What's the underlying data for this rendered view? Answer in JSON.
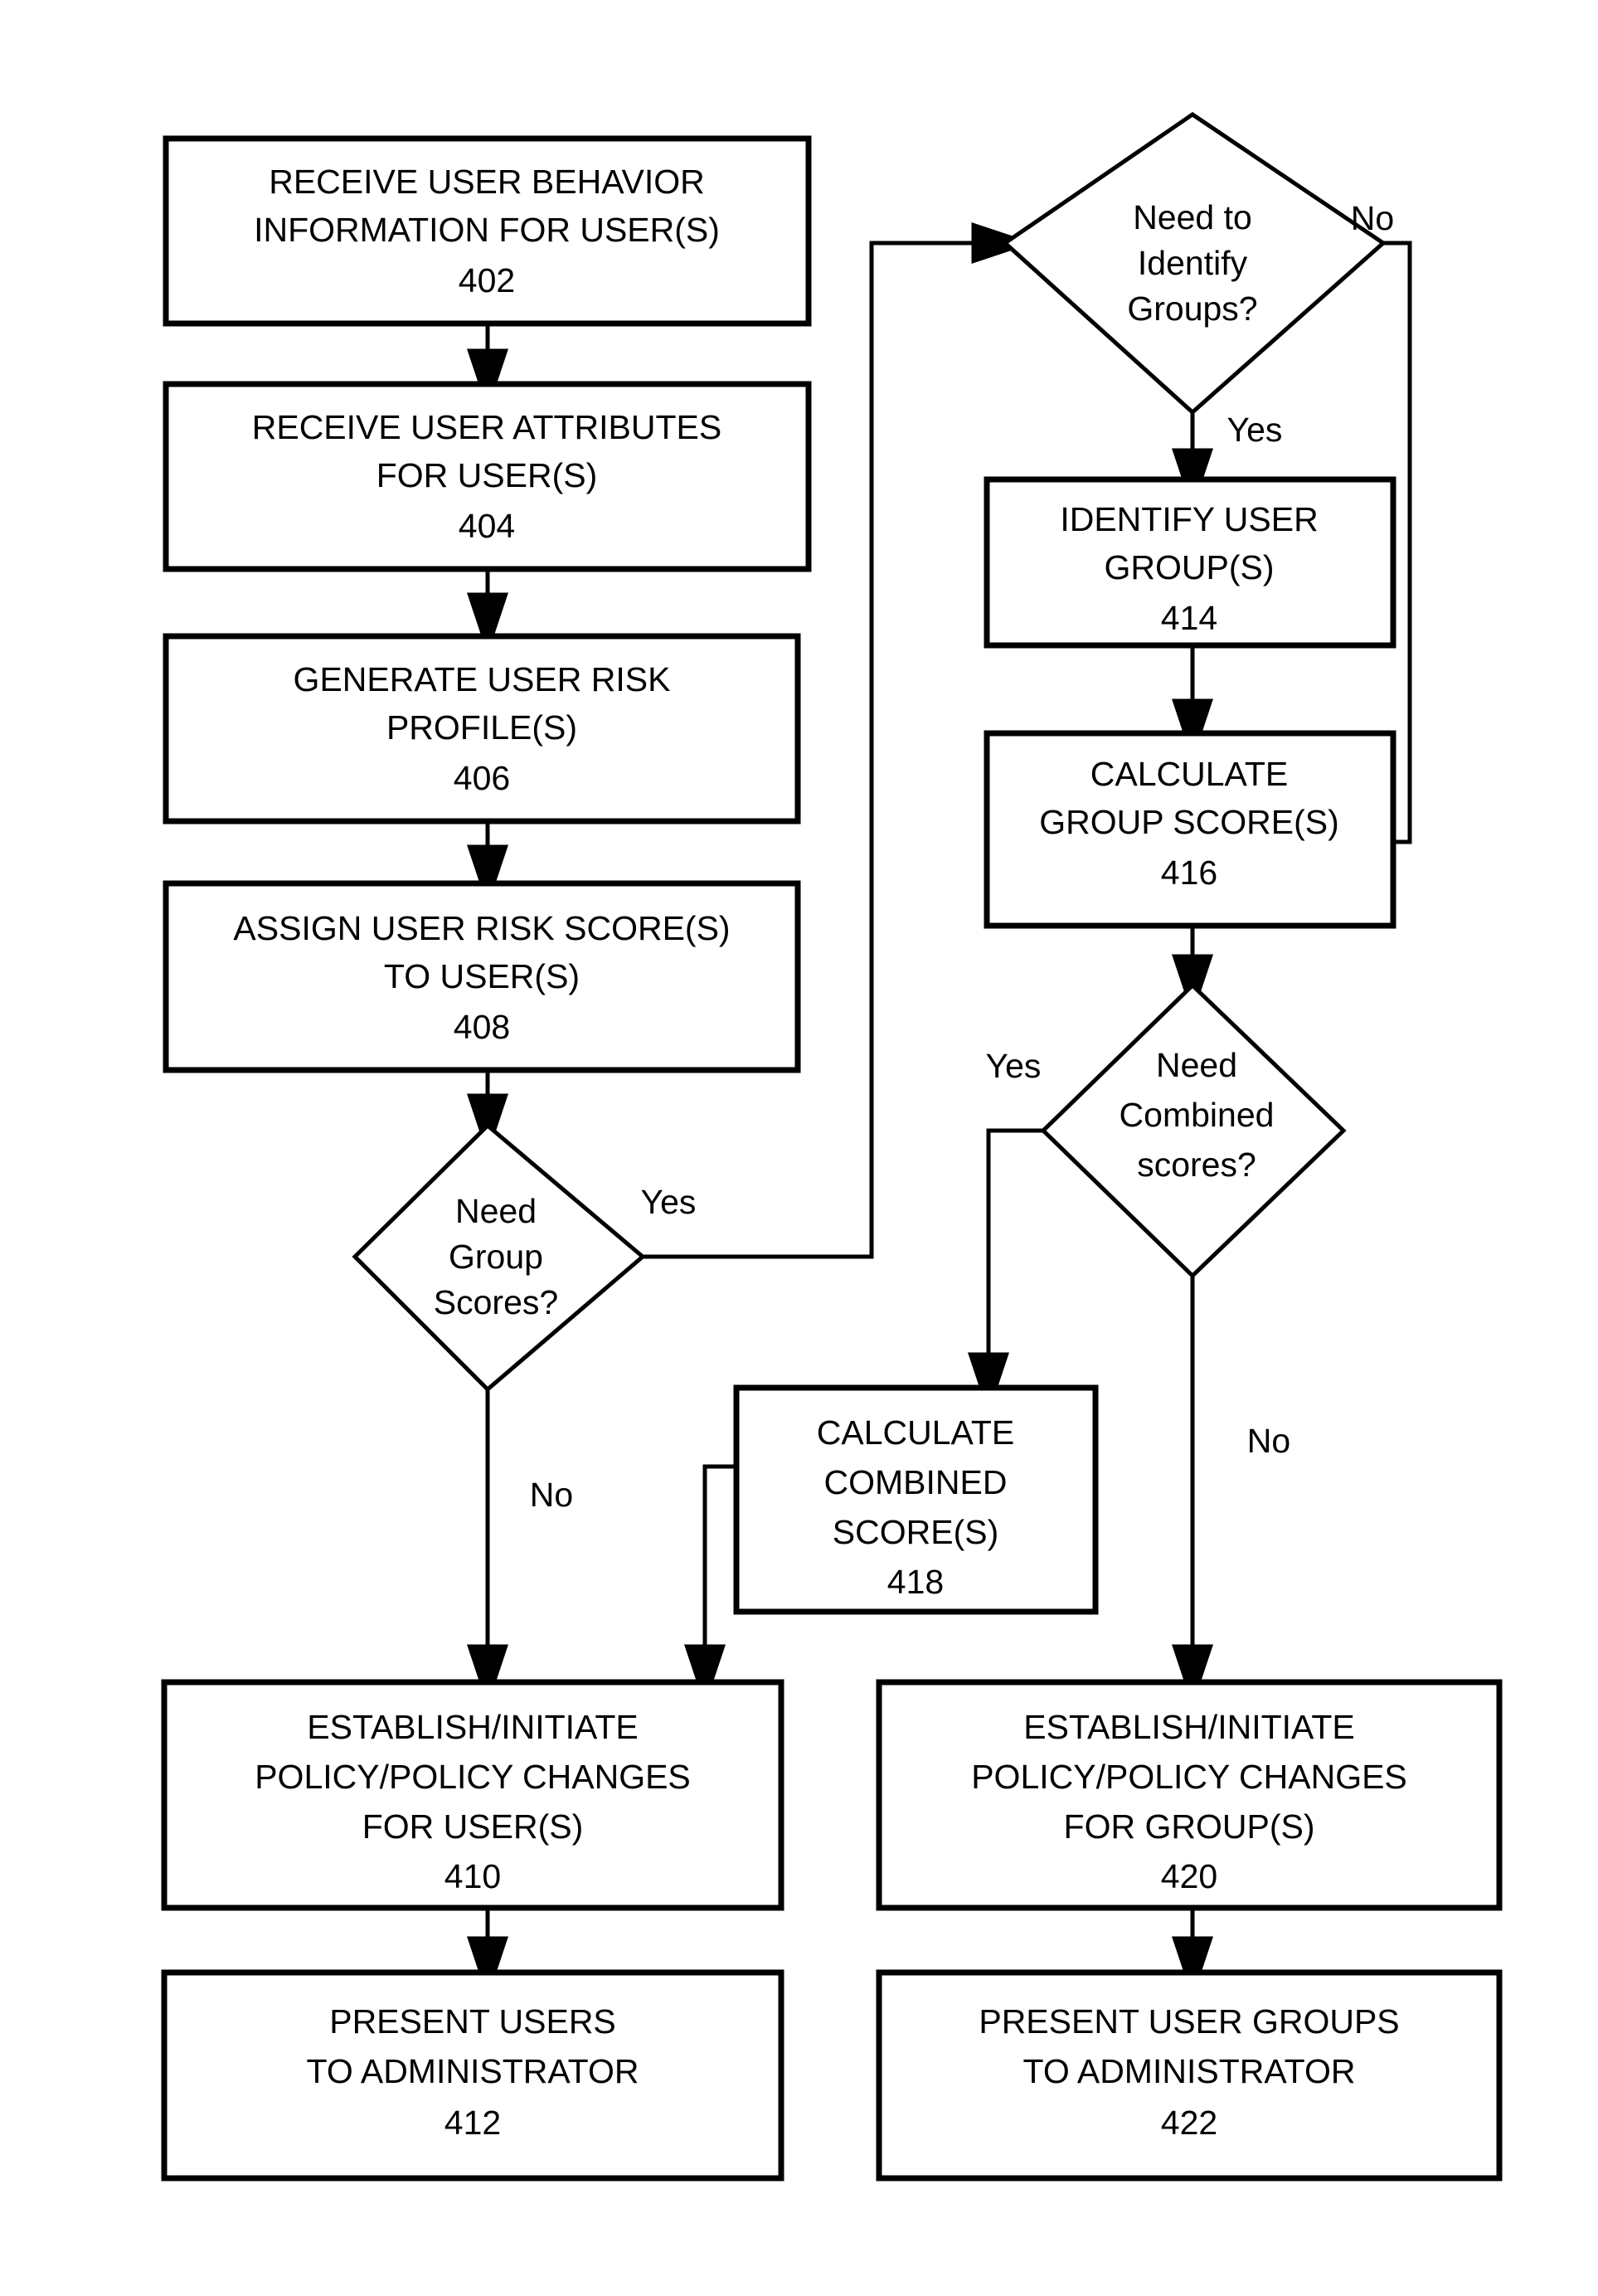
{
  "figure": {
    "type": "process-flowchart",
    "background_color": "#ffffff",
    "line_color": "#000000",
    "text_color": "#000000"
  },
  "nodes": {
    "n402": {
      "shape": "process",
      "line1": "RECEIVE USER BEHAVIOR",
      "line2": "INFORMATION FOR USER(S)",
      "ref": "402"
    },
    "n404": {
      "shape": "process",
      "line1": "RECEIVE USER ATTRIBUTES",
      "line2": "FOR USER(S)",
      "ref": "404"
    },
    "n406": {
      "shape": "process",
      "line1": "GENERATE USER RISK",
      "line2": "PROFILE(S)",
      "ref": "406"
    },
    "n408": {
      "shape": "process",
      "line1": "ASSIGN USER RISK SCORE(S)",
      "line2": "TO USER(S)",
      "ref": "408"
    },
    "n410": {
      "shape": "process",
      "line1": "ESTABLISH/INITIATE",
      "line2": "POLICY/POLICY CHANGES",
      "line3": "FOR USER(S)",
      "ref": "410"
    },
    "n412": {
      "shape": "process",
      "line1": "PRESENT USERS",
      "line2": "TO ADMINISTRATOR",
      "ref": "412"
    },
    "n414": {
      "shape": "process",
      "line1": "IDENTIFY USER",
      "line2": "GROUP(S)",
      "ref": "414"
    },
    "n416": {
      "shape": "process",
      "line1": "CALCULATE",
      "line2": "GROUP SCORE(S)",
      "ref": "416"
    },
    "n418": {
      "shape": "process",
      "line1": "CALCULATE",
      "line2": "COMBINED",
      "line3": "SCORE(S)",
      "ref": "418"
    },
    "n420": {
      "shape": "process",
      "line1": "ESTABLISH/INITIATE",
      "line2": "POLICY/POLICY CHANGES",
      "line3": "FOR GROUP(S)",
      "ref": "420"
    },
    "n422": {
      "shape": "process",
      "line1": "PRESENT USER GROUPS",
      "line2": "TO ADMINISTRATOR",
      "ref": "422"
    },
    "dNeedGroupScores": {
      "shape": "decision",
      "line1": "Need",
      "line2": "Group",
      "line3": "Scores?"
    },
    "dNeedToIdentifyGroups": {
      "shape": "decision",
      "line1": "Need to",
      "line2": "Identify",
      "line3": "Groups?"
    },
    "dNeedCombinedScores": {
      "shape": "decision",
      "line1": "Need",
      "line2": "Combined",
      "line3": "scores?"
    }
  },
  "edge_labels": {
    "group_scores_yes": "Yes",
    "group_scores_no": "No",
    "identify_groups_no": "No",
    "identify_groups_yes": "Yes",
    "combined_scores_yes": "Yes",
    "combined_scores_no": "No"
  }
}
